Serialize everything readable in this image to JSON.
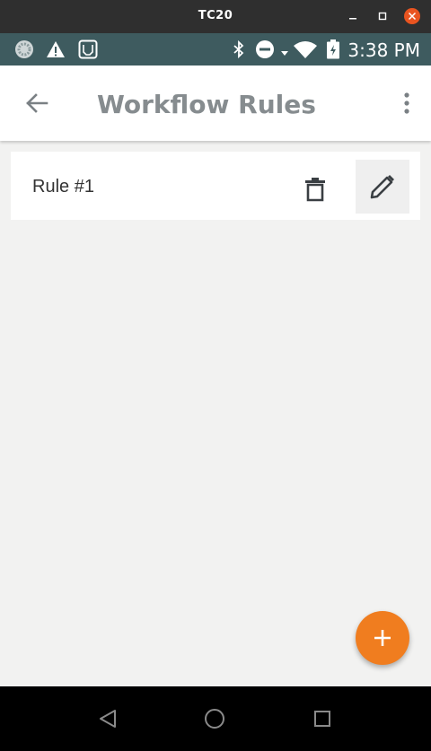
{
  "window": {
    "title": "TC20"
  },
  "statusbar": {
    "time": "3:38 PM",
    "icons": [
      "camera-icon",
      "warning-icon",
      "sd-card-icon",
      "bluetooth-icon",
      "do-not-disturb-icon",
      "wifi-icon",
      "battery-charging-icon"
    ]
  },
  "appbar": {
    "title": "Workflow Rules",
    "back_icon": "arrow-left-icon",
    "menu_icon": "more-vert-icon"
  },
  "rules": [
    {
      "label": "Rule #1"
    }
  ],
  "fab": {
    "icon": "plus-icon"
  },
  "navbar": {
    "icons": [
      "back-triangle-icon",
      "home-circle-icon",
      "recents-square-icon"
    ]
  },
  "colors": {
    "titlebar": "#2f2f2f",
    "statusbar": "#3e5b5f",
    "accent": "#f07d1f",
    "close": "#e95420",
    "background": "#f2f2f1"
  }
}
